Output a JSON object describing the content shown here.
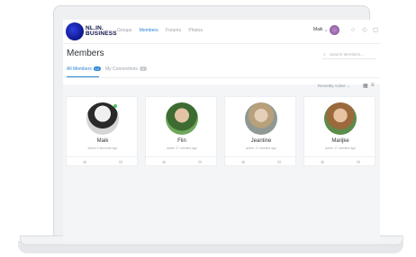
{
  "brand": {
    "line1": "NL.IN.",
    "line2": "BUSINESS"
  },
  "nav": {
    "items": [
      "Groups",
      "Members",
      "Forums",
      "Photos"
    ],
    "active_index": 1
  },
  "user": {
    "name": "Maik"
  },
  "page": {
    "title": "Members"
  },
  "search": {
    "placeholder": "Search Members..."
  },
  "tabs": [
    {
      "label": "All Members",
      "count": "12"
    },
    {
      "label": "My Connections",
      "count": "0"
    }
  ],
  "sort": {
    "label": "Recently Active"
  },
  "members": [
    {
      "name": "Maik",
      "active": "active 0 seconds ago",
      "avatar_color": "#d7d7d7"
    },
    {
      "name": "Flin",
      "active": "active 17 minutes ago",
      "avatar_color": "#6fa85a"
    },
    {
      "name": "Jeantine",
      "active": "active 17 minutes ago",
      "avatar_color": "#9fa6a1"
    },
    {
      "name": "Marijke",
      "active": "active 17 minutes ago",
      "avatar_color": "#5c8c4b"
    }
  ],
  "colors": {
    "accent": "#2a84d7",
    "online": "#4fbf5b",
    "brand_dark": "#0d1447"
  }
}
